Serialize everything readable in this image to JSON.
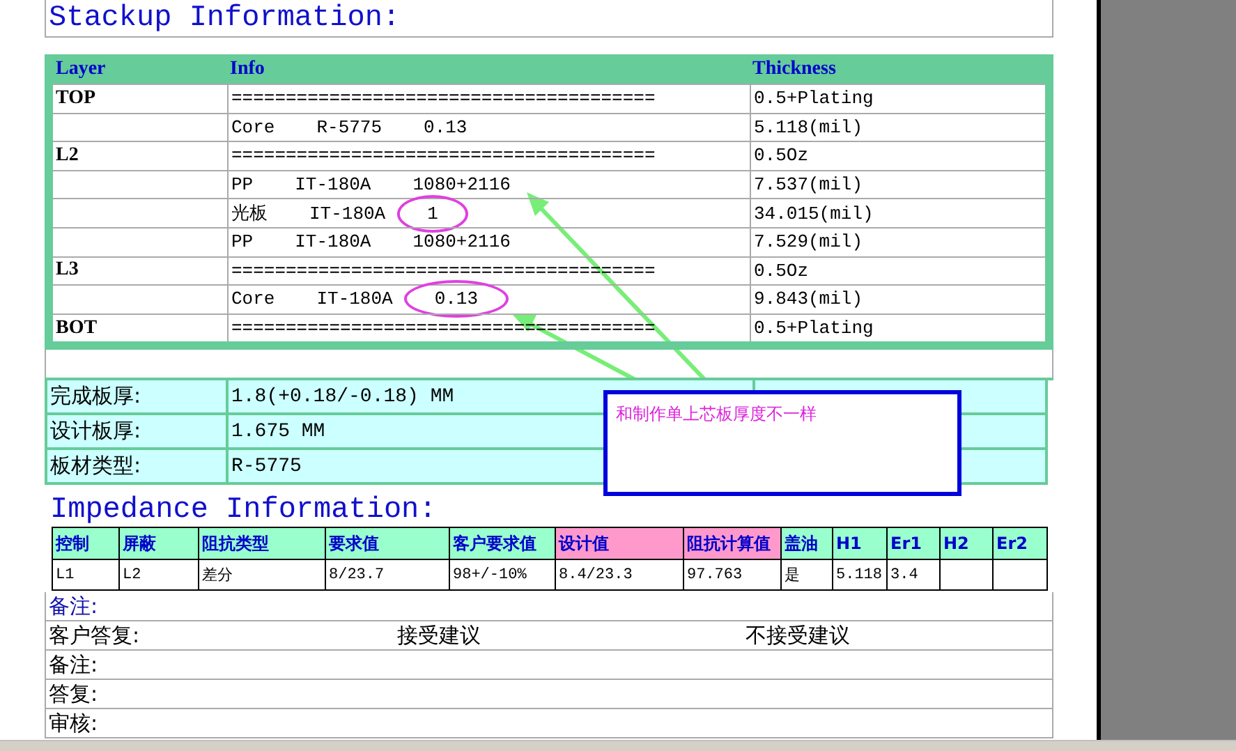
{
  "stackup": {
    "title": "Stackup Information:",
    "columns": [
      "Layer",
      "Info",
      "Thickness"
    ],
    "rows": [
      {
        "layer": "TOP",
        "info": [
          "======================================="
        ],
        "thickness": "0.5+Plating"
      },
      {
        "layer": "",
        "info": [
          "Core",
          "R-5775",
          "0.13"
        ],
        "thickness": "5.118(mil)"
      },
      {
        "layer": "L2",
        "info": [
          "======================================="
        ],
        "thickness": "0.5Oz"
      },
      {
        "layer": "",
        "info": [
          "PP",
          "IT-180A",
          "1080+2116"
        ],
        "thickness": "7.537(mil)"
      },
      {
        "layer": "",
        "info": [
          "光板",
          "IT-180A",
          "1"
        ],
        "thickness": "34.015(mil)",
        "circled": true
      },
      {
        "layer": "",
        "info": [
          "PP",
          "IT-180A",
          "1080+2116"
        ],
        "thickness": "7.529(mil)"
      },
      {
        "layer": "L3",
        "info": [
          "======================================="
        ],
        "thickness": "0.5Oz"
      },
      {
        "layer": "",
        "info": [
          "Core",
          "IT-180A",
          "0.13"
        ],
        "thickness": "9.843(mil)",
        "circled": true
      },
      {
        "layer": "BOT",
        "info": [
          "======================================="
        ],
        "thickness": "0.5+Plating"
      }
    ]
  },
  "board_info": [
    {
      "label": "完成板厚:",
      "value": "1.8(+0.18/-0.18) MM"
    },
    {
      "label": "设计板厚:",
      "value": "1.675 MM"
    },
    {
      "label": "板材类型:",
      "value": "R-5775"
    }
  ],
  "impedance": {
    "title": "Impedance Information:",
    "columns": [
      {
        "label": "控制",
        "color": "#99ffcc"
      },
      {
        "label": "屏蔽",
        "color": "#99ffcc"
      },
      {
        "label": "阻抗类型",
        "color": "#99ffcc"
      },
      {
        "label": "要求值",
        "color": "#99ffcc"
      },
      {
        "label": "客户要求值",
        "color": "#99ffcc"
      },
      {
        "label": "设计值",
        "color": "#ff99cc"
      },
      {
        "label": "阻抗计算值",
        "color": "#ff99cc"
      },
      {
        "label": "盖油",
        "color": "#99ffcc"
      },
      {
        "label": "H1",
        "color": "#99ffcc"
      },
      {
        "label": "Er1",
        "color": "#99ffcc"
      },
      {
        "label": "H2",
        "color": "#99ffcc"
      },
      {
        "label": "Er2",
        "color": "#99ffcc"
      }
    ],
    "rows": [
      [
        "L1",
        "L2",
        "差分",
        "8/23.7",
        "98+/-10%",
        "8.4/23.3",
        "97.763",
        "是",
        "5.118",
        "3.4",
        null,
        null
      ]
    ]
  },
  "remarks": [
    {
      "kind": "note",
      "texts": [
        "备注:"
      ]
    },
    {
      "kind": "choice",
      "texts": [
        "客户答复:",
        "接受建议",
        "不接受建议"
      ]
    },
    {
      "kind": "plain",
      "texts": [
        "备注:"
      ]
    },
    {
      "kind": "plain",
      "texts": [
        "答复:"
      ]
    },
    {
      "kind": "plain",
      "texts": [
        "审核:"
      ]
    }
  ],
  "callout": {
    "text": "和制作单上芯板厚度不一样"
  }
}
